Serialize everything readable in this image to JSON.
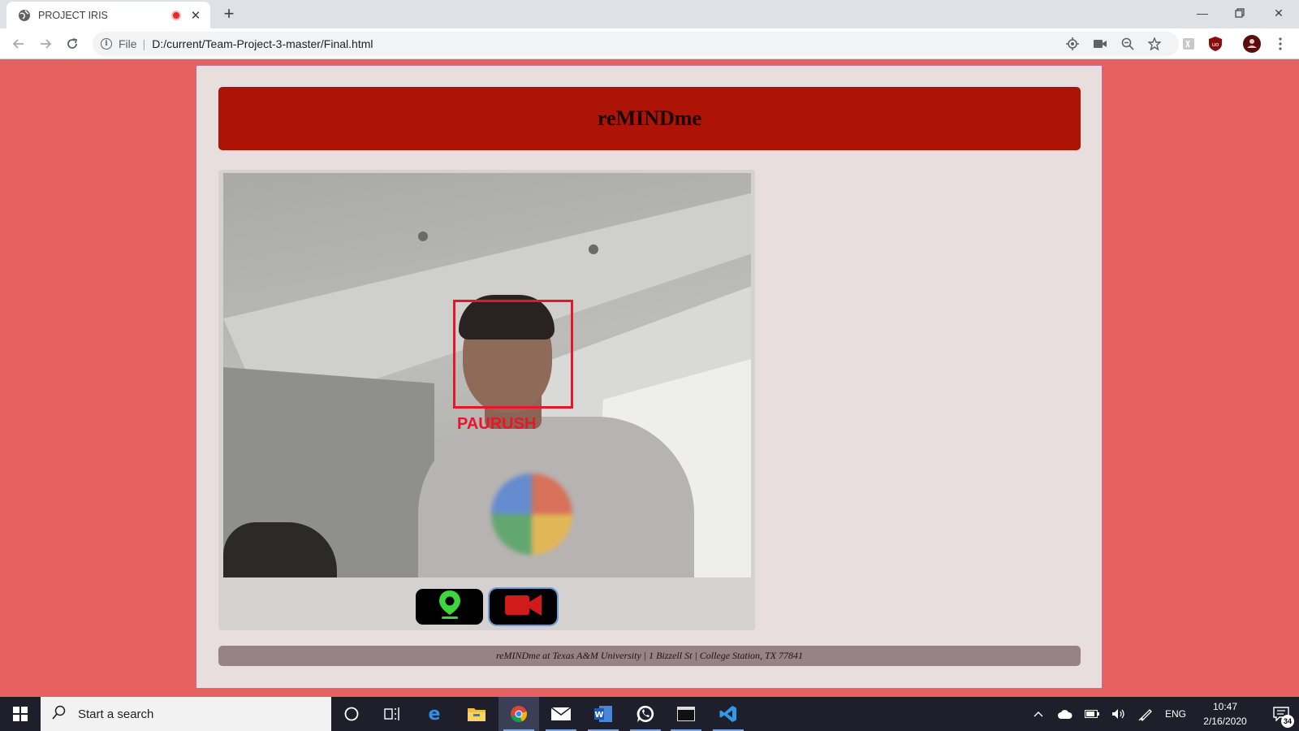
{
  "browser": {
    "tab": {
      "title": "PROJECT IRIS",
      "favicon": "globe-icon",
      "recording": true
    },
    "newtab_icon": "plus-icon",
    "window_controls": [
      "minimize-icon",
      "restore-icon",
      "close-icon"
    ],
    "address": {
      "scheme": "File",
      "url": "D:/current/Team-Project-3-master/Final.html"
    },
    "toolbar_icons": [
      "location-icon",
      "camera-icon",
      "zoom-icon",
      "star-icon",
      "extension-icon",
      "ublock-icon",
      "profile-avatar",
      "menu-icon"
    ]
  },
  "page": {
    "title": "reMINDme",
    "video": {
      "face_label": "PAURUSH",
      "box_color": "#e8162a"
    },
    "buttons": [
      {
        "name": "location-button",
        "icon": "map-pin-icon",
        "color": "#3dd63d"
      },
      {
        "name": "video-button",
        "icon": "video-camera-icon",
        "color": "#d11a1a"
      }
    ],
    "footer": "reMINDme at Texas A&M University | 1 Bizzell St | College Station, TX 77841"
  },
  "colors": {
    "page_bg": "#e86161",
    "banner_bg": "#ad1405",
    "footer_bg": "#978287"
  },
  "taskbar": {
    "search_placeholder": "Start a search",
    "apps": [
      "cortana-icon",
      "task-view-icon",
      "edge-icon",
      "file-explorer-icon",
      "chrome-icon",
      "mail-icon",
      "word-icon",
      "whatsapp-icon",
      "terminal-icon",
      "vscode-icon"
    ],
    "language": "ENG",
    "time": "10:47",
    "date": "2/16/2020",
    "notifications": "34"
  }
}
